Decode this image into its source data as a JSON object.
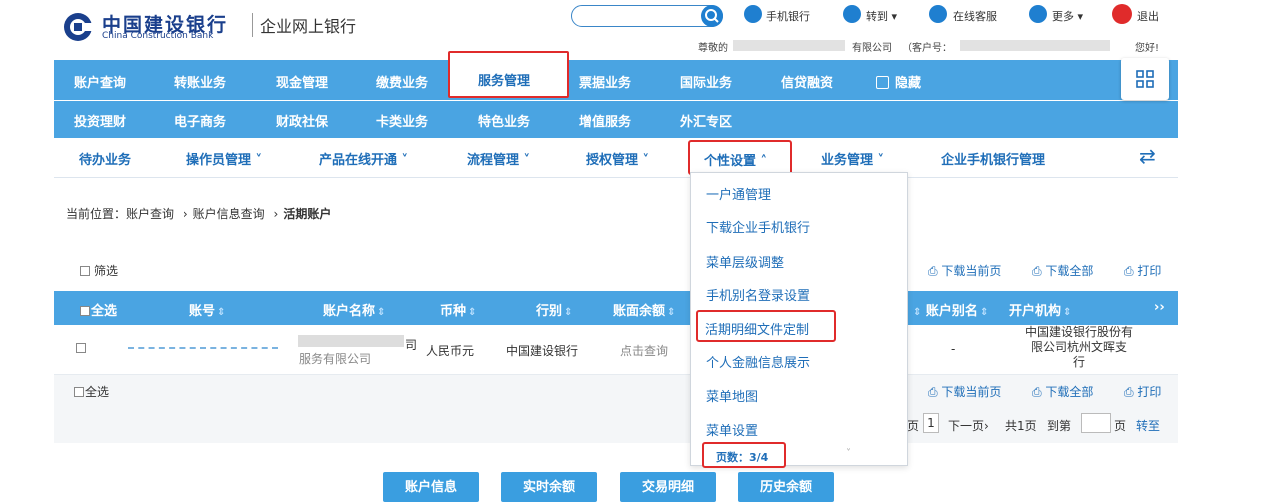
{
  "header": {
    "brand_cn": "中国建设银行",
    "brand_en": "China Construction Bank",
    "subtitle": "企业网上银行",
    "links": [
      "手机银行",
      "转到",
      "在线客服",
      "更多",
      "退出"
    ],
    "greeting_prefix": "尊敬的",
    "greeting_company_suffix": "有限公司",
    "customer_no_label": "（客户号：",
    "greeting_suffix": "您好!"
  },
  "nav_row1": [
    "账户查询",
    "转账业务",
    "现金管理",
    "缴费业务",
    "服务管理",
    "票据业务",
    "国际业务",
    "信贷融资",
    "隐藏"
  ],
  "nav_row2": [
    "投资理财",
    "电子商务",
    "财政社保",
    "卡类业务",
    "特色业务",
    "增值服务",
    "外汇专区"
  ],
  "subnav": [
    "待办业务",
    "操作员管理",
    "产品在线开通",
    "流程管理",
    "授权管理",
    "个性设置",
    "业务管理",
    "企业手机银行管理"
  ],
  "breadcrumb": {
    "label": "当前位置：",
    "path1": "账户查询",
    "path2": "账户信息查询",
    "current": "活期账户",
    "sep": "›"
  },
  "filter_label": "筛选",
  "actions": {
    "download_page": "下载当前页",
    "download_all": "下载全部",
    "print": "打印"
  },
  "table": {
    "headers": [
      "全选",
      "账号",
      "账户名称",
      "币种",
      "行别",
      "账面余额",
      "账户别名",
      "开户机构"
    ],
    "row": {
      "name_fragment1": "司",
      "name_fragment2": "服务有限公司",
      "currency": "人民币元",
      "bank": "中国建设银行",
      "balance": "点击查询",
      "alias": "-",
      "branch_line1": "中国建设银行股份有",
      "branch_line2": "限公司杭州文晖支",
      "branch_line3": "行"
    }
  },
  "footer": {
    "select_all": "全选",
    "pager_prefix": "页",
    "page_no": "1",
    "next": "下一页›",
    "total": "共1页",
    "goto": "到第",
    "page_unit": "页",
    "go": "转至"
  },
  "dropdown": {
    "items": [
      "一户通管理",
      "下载企业手机银行",
      "菜单层级调整",
      "手机别名登录设置",
      "活期明细文件定制",
      "个人金融信息展示",
      "菜单地图",
      "菜单设置"
    ],
    "page_indicator": "页数：3/4"
  },
  "bottom_buttons": [
    "账户信息",
    "实时余额",
    "交易明细",
    "历史余额"
  ],
  "colors": {
    "nav_bg": "#4aa4e2",
    "link": "#1f6eb8",
    "highlight": "#e02b2b"
  }
}
